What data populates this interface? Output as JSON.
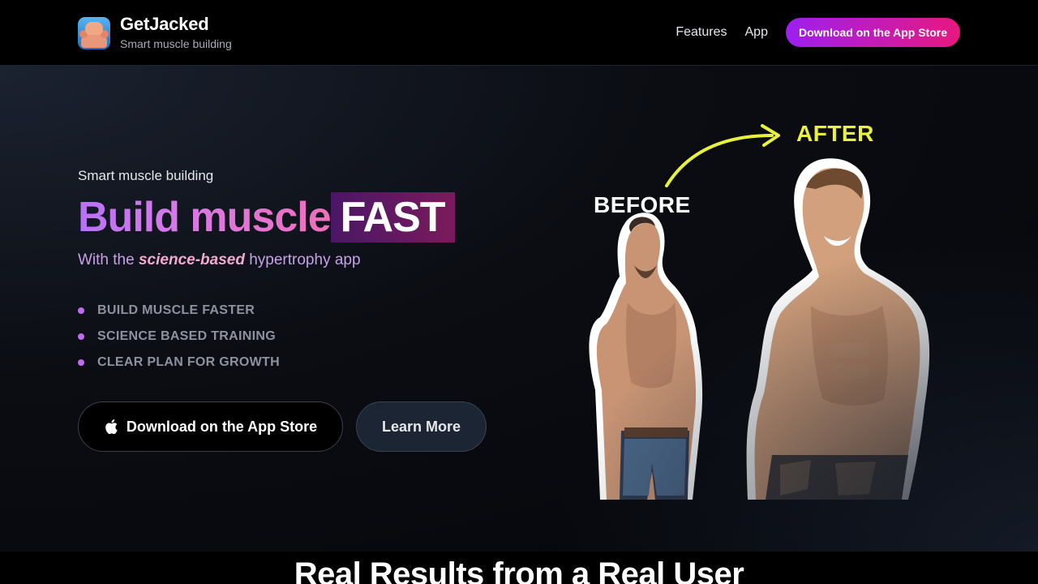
{
  "header": {
    "brand_name": "GetJacked",
    "brand_tagline": "Smart muscle building",
    "nav": [
      "Features",
      "App"
    ],
    "cta": "Download on the App Store"
  },
  "hero": {
    "eyebrow": "Smart muscle building",
    "headline_main": "Build muscle",
    "headline_highlight": "FAST",
    "tagline_prefix": "With the ",
    "tagline_emphasis": "science-based",
    "tagline_suffix": " hypertrophy app",
    "bullets": [
      "BUILD MUSCLE FASTER",
      "SCIENCE BASED TRAINING",
      "CLEAR PLAN FOR GROWTH"
    ],
    "primary_button": "Download on the App Store",
    "secondary_button": "Learn More",
    "image": {
      "before_label": "BEFORE",
      "after_label": "AFTER"
    }
  },
  "section": {
    "title": "Real Results from a Real User"
  },
  "colors": {
    "accent_purple": "#9d1ff0",
    "accent_pink": "#e8187f",
    "after_label": "#e9f23b",
    "bullet_dot": "#c06cf0"
  },
  "icons": [
    "app-logo-icon",
    "apple-icon",
    "arrow-icon"
  ]
}
